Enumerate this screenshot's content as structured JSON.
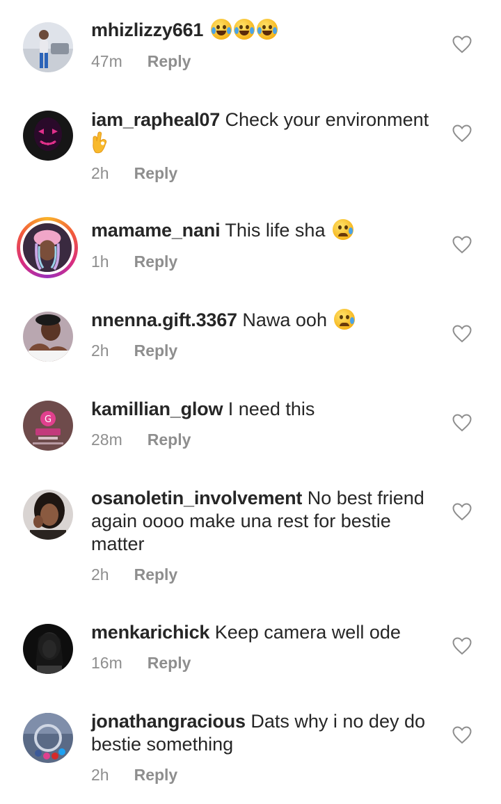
{
  "comments": [
    {
      "username": "mhizlizzy661",
      "text": "",
      "emoji": [
        "😂",
        "😂",
        "😂"
      ],
      "time": "47m",
      "reply": "Reply"
    },
    {
      "username": "iam_rapheal07",
      "text": "Check your environment",
      "emoji": [
        "👌"
      ],
      "time": "2h",
      "reply": "Reply"
    },
    {
      "username": "mamame_nani",
      "text": "This life sha",
      "emoji": [
        "😢"
      ],
      "time": "1h",
      "reply": "Reply"
    },
    {
      "username": "nnenna.gift.3367",
      "text": "Nawa ooh",
      "emoji": [
        "😢"
      ],
      "time": "2h",
      "reply": "Reply"
    },
    {
      "username": "kamillian_glow",
      "text": "I need this",
      "time": "28m",
      "reply": "Reply"
    },
    {
      "username": "osanoletin_involvement",
      "text": "No best friend again oooo make una rest for bestie matter",
      "time": "2h",
      "reply": "Reply"
    },
    {
      "username": "menkarichick",
      "text": "Keep camera well ode",
      "time": "16m",
      "reply": "Reply"
    },
    {
      "username": "jonathangracious",
      "text": "Dats why i no dey do bestie something",
      "time": "2h",
      "reply": "Reply"
    }
  ],
  "icons": {
    "like": "heart-outline-icon",
    "laugh_cry": "face-with-tears-of-joy-icon",
    "sad": "crying-face-icon",
    "ok": "ok-hand-icon"
  },
  "colors": {
    "text": "#262626",
    "secondary": "#8e8e8e",
    "story_ring_start": "#f9b42a",
    "story_ring_end": "#d92e7f"
  }
}
